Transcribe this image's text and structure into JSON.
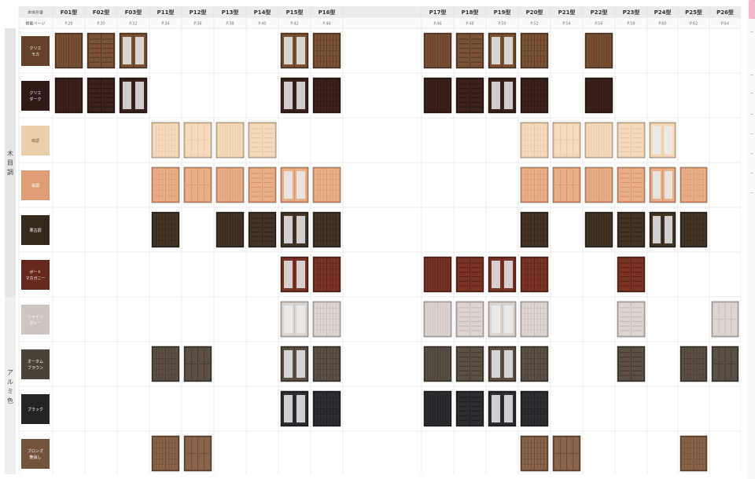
{
  "header": {
    "label_model": "本体形番",
    "label_page": "掲載ページ"
  },
  "models": [
    {
      "code": "F01型",
      "page": "P.28"
    },
    {
      "code": "F02型",
      "page": "P.30"
    },
    {
      "code": "F03型",
      "page": "P.32"
    },
    {
      "code": "P11型",
      "page": "P.34"
    },
    {
      "code": "P12型",
      "page": "P.36"
    },
    {
      "code": "P13型",
      "page": "P.38"
    },
    {
      "code": "P14型",
      "page": "P.40"
    },
    {
      "code": "P15型",
      "page": "P.42"
    },
    {
      "code": "P16型",
      "page": "P.44"
    },
    {
      "code": "",
      "page": ""
    },
    {
      "code": "P17型",
      "page": "P.46"
    },
    {
      "code": "P18型",
      "page": "P.48"
    },
    {
      "code": "P19型",
      "page": "P.50"
    },
    {
      "code": "P20型",
      "page": "P.52"
    },
    {
      "code": "P21型",
      "page": "P.54"
    },
    {
      "code": "P22型",
      "page": "P.56"
    },
    {
      "code": "P23型",
      "page": "P.58"
    },
    {
      "code": "P24型",
      "page": "P.60"
    },
    {
      "code": "P25型",
      "page": "P.62"
    },
    {
      "code": "P26型",
      "page": "P.64"
    }
  ],
  "groups": [
    {
      "label": "木目調",
      "rows": [
        0,
        1,
        2,
        3,
        4,
        5
      ]
    },
    {
      "label": "アルミ色",
      "rows": [
        6,
        7,
        8,
        9
      ]
    }
  ],
  "colors": [
    {
      "name": "クリエ\nモカ",
      "frame": "#5a3a22",
      "panel": "#7a5235",
      "text": "#ffffff",
      "available": [
        0,
        1,
        2,
        7,
        8,
        10,
        11,
        12,
        13,
        15
      ]
    },
    {
      "name": "クリエ\nダーク",
      "frame": "#2a1613",
      "panel": "#3d211c",
      "text": "#ffffff",
      "available": [
        0,
        1,
        2,
        7,
        8,
        10,
        11,
        12,
        13,
        15
      ]
    },
    {
      "name": "柿調",
      "frame": "#e9c7a0",
      "panel": "#f3dcbd",
      "text": "#7a5a3a",
      "available": [
        3,
        4,
        5,
        6,
        13,
        14,
        15,
        16,
        17
      ]
    },
    {
      "name": "桜調",
      "frame": "#d9966a",
      "panel": "#e8b08a",
      "text": "#ffffff",
      "available": [
        3,
        4,
        5,
        6,
        7,
        8,
        13,
        14,
        15,
        16,
        17,
        18
      ]
    },
    {
      "name": "栗古調",
      "frame": "#2e2419",
      "panel": "#433425",
      "text": "#ffffff",
      "available": [
        3,
        5,
        6,
        7,
        8,
        13,
        15,
        16,
        17,
        18
      ]
    },
    {
      "name": "ボート\nマホガニー",
      "frame": "#5b2218",
      "panel": "#7a3424",
      "text": "#ffffff",
      "available": [
        7,
        8,
        10,
        11,
        12,
        13,
        16
      ]
    },
    {
      "name": "シャイン\nグレー",
      "frame": "#c7bdb8",
      "panel": "#ddd5d0",
      "text": "#ffffff",
      "available": [
        7,
        8,
        10,
        11,
        12,
        13,
        16,
        19
      ]
    },
    {
      "name": "オータム\nブラウン",
      "frame": "#433a31",
      "panel": "#5a5046",
      "text": "#ffffff",
      "available": [
        3,
        4,
        7,
        8,
        10,
        11,
        12,
        13,
        16,
        18,
        19
      ]
    },
    {
      "name": "ブラック",
      "frame": "#1f1e21",
      "panel": "#2e2d31",
      "text": "#ffffff",
      "available": [
        7,
        8,
        10,
        11,
        12,
        13
      ]
    },
    {
      "name": "ブロンズ\n艶消し",
      "frame": "#6b4a34",
      "panel": "#8a644a",
      "text": "#ffffff",
      "available": [
        3,
        4,
        13,
        14,
        18
      ]
    }
  ]
}
